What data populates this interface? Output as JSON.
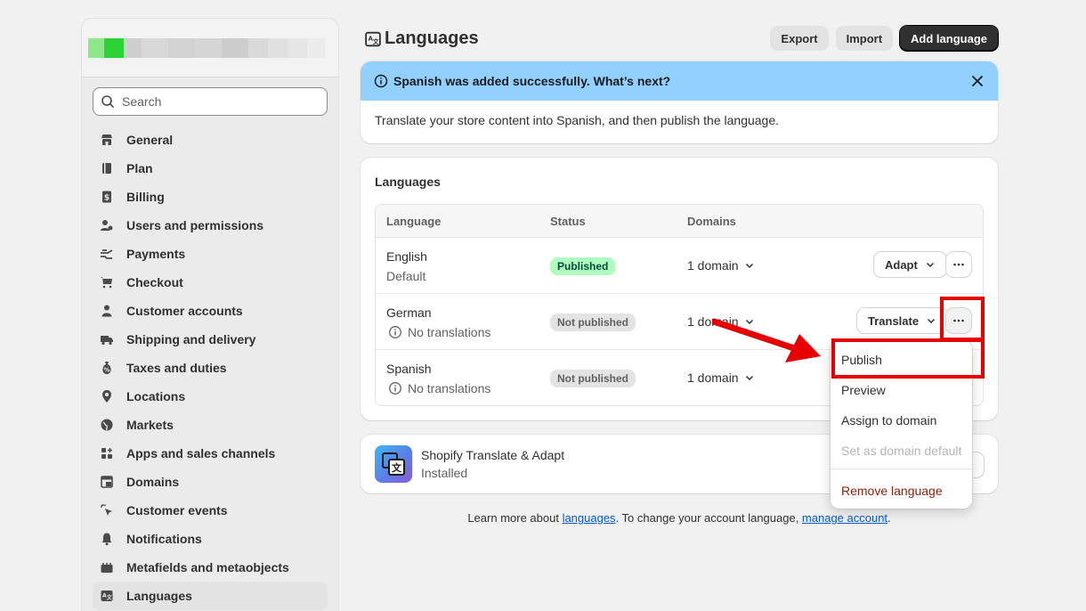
{
  "sidebar": {
    "search_placeholder": "Search",
    "items": [
      {
        "label": "General",
        "icon": "store-icon"
      },
      {
        "label": "Plan",
        "icon": "plan-icon"
      },
      {
        "label": "Billing",
        "icon": "billing-icon"
      },
      {
        "label": "Users and permissions",
        "icon": "users-icon"
      },
      {
        "label": "Payments",
        "icon": "payments-icon"
      },
      {
        "label": "Checkout",
        "icon": "cart-icon"
      },
      {
        "label": "Customer accounts",
        "icon": "person-icon"
      },
      {
        "label": "Shipping and delivery",
        "icon": "truck-icon"
      },
      {
        "label": "Taxes and duties",
        "icon": "taxes-icon"
      },
      {
        "label": "Locations",
        "icon": "location-icon"
      },
      {
        "label": "Markets",
        "icon": "globe-icon"
      },
      {
        "label": "Apps and sales channels",
        "icon": "apps-icon"
      },
      {
        "label": "Domains",
        "icon": "domain-icon"
      },
      {
        "label": "Customer events",
        "icon": "cursor-icon"
      },
      {
        "label": "Notifications",
        "icon": "bell-icon"
      },
      {
        "label": "Metafields and metaobjects",
        "icon": "metafields-icon"
      },
      {
        "label": "Languages",
        "icon": "language-icon"
      }
    ]
  },
  "header": {
    "title": "Languages",
    "export_label": "Export",
    "import_label": "Import",
    "add_label": "Add language"
  },
  "banner": {
    "title": "Spanish was added successfully. What’s next?",
    "body": "Translate your store content into Spanish, and then publish the language."
  },
  "languages_card": {
    "title": "Languages",
    "columns": [
      "Language",
      "Status",
      "Domains"
    ],
    "rows": [
      {
        "name": "English",
        "sub": "Default",
        "status": "Published",
        "domains": "1 domain",
        "action": "Adapt"
      },
      {
        "name": "German",
        "sub": "No translations",
        "status": "Not published",
        "domains": "1 domain",
        "action": "Translate"
      },
      {
        "name": "Spanish",
        "sub": "No translations",
        "status": "Not published",
        "domains": "1 domain",
        "action": ""
      }
    ]
  },
  "app_card": {
    "name": "Shopify Translate & Adapt",
    "status": "Installed"
  },
  "footer": {
    "prefix": "Learn more about ",
    "link1": "languages",
    "middle": ". To change your account language, ",
    "link2": "manage account",
    "suffix": "."
  },
  "menu": {
    "items": [
      "Publish",
      "Preview",
      "Assign to domain",
      "Set as domain default",
      "Remove language"
    ]
  },
  "colors": {
    "banner_bg": "#91d0ff",
    "published_badge": "#affebf",
    "annotation_red": "#e60000",
    "primary_button": "#303030"
  }
}
